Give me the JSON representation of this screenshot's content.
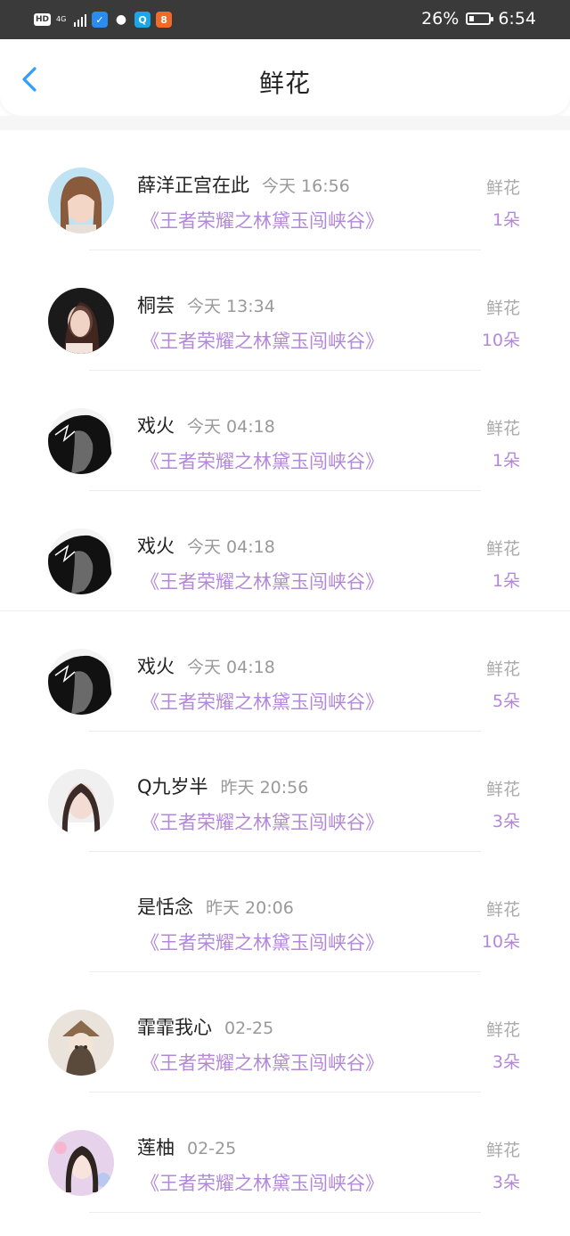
{
  "status_bar": {
    "hd": "HD",
    "network": "4G",
    "battery": "26%",
    "battery_level": 0.26,
    "time": "6:54"
  },
  "header": {
    "title": "鲜花",
    "back_icon": "chevron-left-icon",
    "accent": "#2f9fff"
  },
  "colors": {
    "link": "#b388d8",
    "muted": "#999999"
  },
  "records": [
    {
      "user": "薛洋正宫在此",
      "time": "今天 16:56",
      "book": "《王者荣耀之林黛玉闯峡谷》",
      "kind": "鲜花",
      "qty": "1朵"
    },
    {
      "user": "桐芸",
      "time": "今天 13:34",
      "book": "《王者荣耀之林黛玉闯峡谷》",
      "kind": "鲜花",
      "qty": "10朵"
    },
    {
      "user": "戏火",
      "time": "今天 04:18",
      "book": "《王者荣耀之林黛玉闯峡谷》",
      "kind": "鲜花",
      "qty": "1朵"
    },
    {
      "user": "戏火",
      "time": "今天 04:18",
      "book": "《王者荣耀之林黛玉闯峡谷》",
      "kind": "鲜花",
      "qty": "1朵"
    },
    {
      "user": "戏火",
      "time": "今天 04:18",
      "book": "《王者荣耀之林黛玉闯峡谷》",
      "kind": "鲜花",
      "qty": "5朵"
    },
    {
      "user": "Q九岁半",
      "time": "昨天 20:56",
      "book": "《王者荣耀之林黛玉闯峡谷》",
      "kind": "鲜花",
      "qty": "3朵"
    },
    {
      "user": "是恬念",
      "time": "昨天 20:06",
      "book": "《王者荣耀之林黛玉闯峡谷》",
      "kind": "鲜花",
      "qty": "10朵"
    },
    {
      "user": "霏霏我心",
      "time": "02-25",
      "book": "《王者荣耀之林黛玉闯峡谷》",
      "kind": "鲜花",
      "qty": "3朵"
    },
    {
      "user": "莲柚",
      "time": "02-25",
      "book": "《王者荣耀之林黛玉闯峡谷》",
      "kind": "鲜花",
      "qty": "3朵"
    }
  ]
}
